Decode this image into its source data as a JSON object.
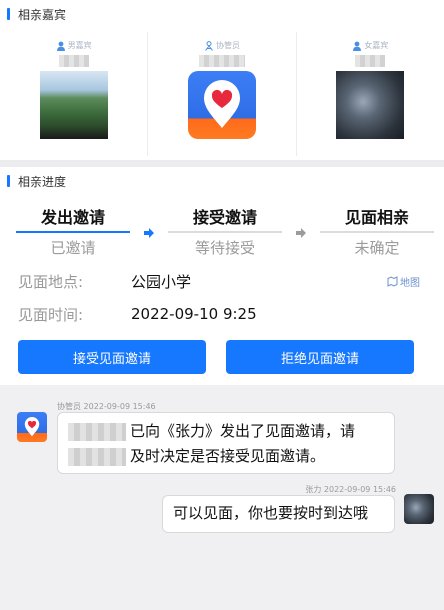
{
  "guests_section": {
    "title": "相亲嘉宾",
    "items": [
      {
        "role": "男嘉宾",
        "photo": "landscape-photo"
      },
      {
        "role": "协管员",
        "photo": "app-logo"
      },
      {
        "role": "女嘉宾",
        "photo": "dark-photo"
      }
    ]
  },
  "progress_section": {
    "title": "相亲进度",
    "steps": [
      {
        "name": "发出邀请",
        "status": "已邀请",
        "active": true
      },
      {
        "name": "接受邀请",
        "status": "等待接受",
        "active": false
      },
      {
        "name": "见面相亲",
        "status": "未确定",
        "active": false
      }
    ],
    "location": {
      "label": "见面地点:",
      "value": "公园小学",
      "map_label": "地图"
    },
    "time": {
      "label": "见面时间:",
      "value": "2022-09-10 9:25"
    },
    "accept_button": "接受见面邀请",
    "reject_button": "拒绝见面邀请"
  },
  "chat": {
    "messages": [
      {
        "sender": "协管员",
        "time": "2022-09-09 15:46",
        "line1": "已向《张力》发出了见面邀请，请",
        "line2": "及时决定是否接受见面邀请。"
      },
      {
        "sender": "张力",
        "time": "2022-09-09 15:46",
        "text": "可以见面，你也要按时到达哦"
      }
    ]
  },
  "colors": {
    "accent": "#1677ff",
    "logo_orange": "#ff6a1a",
    "heart": "#e8283c"
  }
}
